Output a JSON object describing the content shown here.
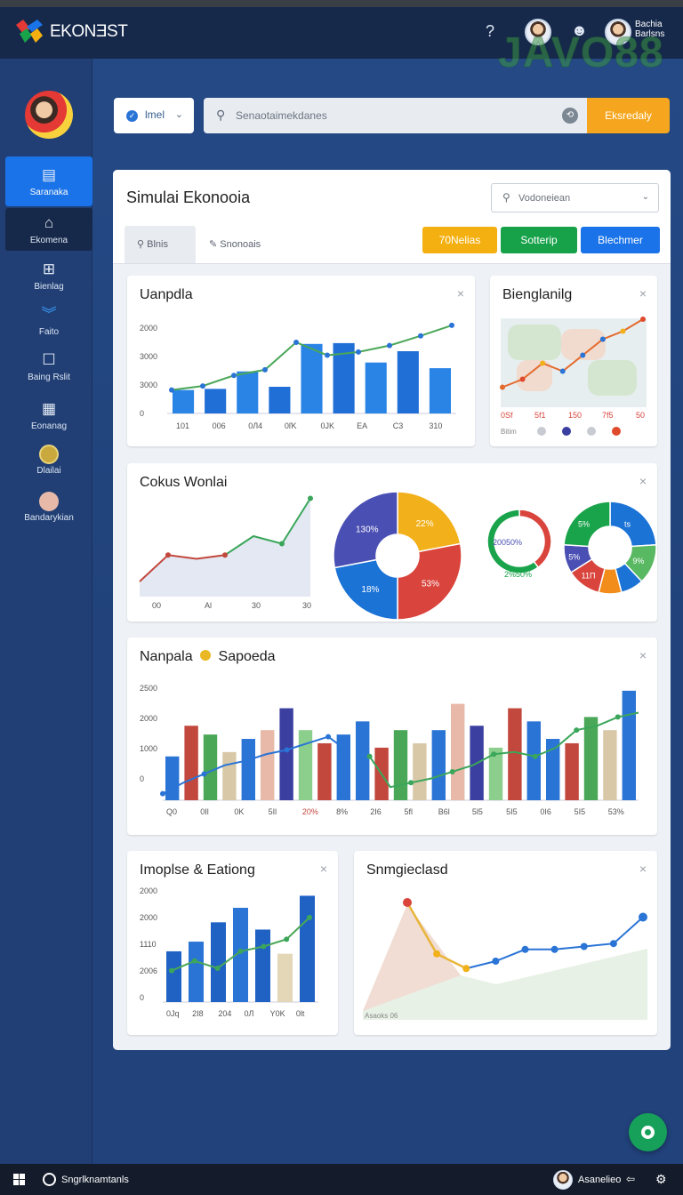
{
  "app": {
    "name": "EKONƎST",
    "watermark": "JAVO88"
  },
  "header": {
    "user_name_line1": "Bachia",
    "user_name_line2": "Barlsns"
  },
  "sidebar": {
    "items": [
      {
        "label": "Saranaka",
        "icon": "inbox-icon"
      },
      {
        "label": "Ekomena",
        "icon": "home-icon"
      },
      {
        "label": "Bienlag",
        "icon": "grid-icon"
      },
      {
        "label": "Faito",
        "icon": "chevrons-icon"
      },
      {
        "label": "Baing Rslit",
        "icon": "square-icon"
      },
      {
        "label": "Eonanag",
        "icon": "table-icon"
      },
      {
        "label": "Dlailai",
        "icon": "coin-icon"
      },
      {
        "label": "Bandarykian",
        "icon": "person-icon"
      }
    ]
  },
  "toolbar": {
    "filter_label": "lmel",
    "search_placeholder": "Senaotaimekdanes",
    "search_button": "Eksredaly"
  },
  "panel": {
    "title": "Simulai Ekonooia",
    "dropdown": "Vodoneiean",
    "tabs": [
      "Blnis",
      "Snonoais"
    ],
    "buttons": [
      {
        "label": "70Nelias",
        "color": "#f4b010"
      },
      {
        "label": "Sotterip",
        "color": "#17a24a"
      },
      {
        "label": "Blechmer",
        "color": "#1a73e8"
      }
    ]
  },
  "cards": {
    "c1": {
      "title": "Uanpdla",
      "close": "×"
    },
    "c2": {
      "title": "Bienglanilg",
      "close": "×",
      "legend_label": "Bitim"
    },
    "c3": {
      "title": "Cokus Wonlai",
      "close": "×"
    },
    "c4": {
      "title": "Nanpala",
      "title2": "Sapoeda",
      "close": "×"
    },
    "c5": {
      "title": "Imoplse & Eationg",
      "close": "×"
    },
    "c6": {
      "title": "Snmgieclasd",
      "close": "×",
      "caption": "Asaoks 06"
    }
  },
  "chart_data": [
    {
      "type": "bar",
      "title": "Uanpdla",
      "y_ticks": [
        "2000",
        "3000",
        "3000",
        "0"
      ],
      "categories": [
        "101",
        "006",
        "0Л4",
        "0ľK",
        "0JK",
        "EA",
        "C3",
        "310"
      ],
      "series": [
        {
          "values": [
            1450,
            1520,
            2600,
            1650,
            4300,
            4350,
            3150,
            3850,
            2800
          ]
        },
        {
          "values": [
            1450,
            1700,
            2350,
            2700,
            4400,
            3600,
            3800,
            4200,
            4800,
            5450
          ]
        }
      ],
      "ylim": [
        0,
        5500
      ]
    },
    {
      "type": "line",
      "title": "Bienglanilg",
      "categories": [
        "0Sf",
        "5f1",
        "150",
        "7f5",
        "50"
      ],
      "values": [
        5,
        15,
        35,
        25,
        45,
        65,
        75,
        90
      ],
      "legend_colors": [
        "#c8ccd2",
        "#3b3fa0",
        "#c8ccd2",
        "#e04a2c"
      ]
    },
    {
      "type": "area",
      "title": "Cokus Wonlai",
      "categories": [
        "00",
        "Al",
        "30",
        "30"
      ],
      "values": [
        20,
        55,
        50,
        55,
        80,
        70,
        130
      ]
    },
    {
      "type": "pie",
      "slices": [
        {
          "label": "22%",
          "value": 22,
          "color": "#f2b01a"
        },
        {
          "label": "53%",
          "value": 28,
          "color": "#d9443c"
        },
        {
          "label": "18%",
          "value": 22,
          "color": "#1c73d6"
        },
        {
          "label": "130%",
          "value": 28,
          "color": "#4a4fb3"
        }
      ]
    },
    {
      "type": "pie",
      "center_label": "20050%",
      "bottom_label": "2%50%",
      "slices": [
        {
          "value": 40,
          "color": "#d9443c"
        },
        {
          "value": 60,
          "color": "#19a34a"
        }
      ]
    },
    {
      "type": "pie",
      "slices": [
        {
          "label": "ts",
          "value": 24,
          "color": "#1c73d6"
        },
        {
          "label": "9%",
          "value": 14,
          "color": "#59b862"
        },
        {
          "label": "",
          "value": 8,
          "color": "#1c73d6"
        },
        {
          "label": "",
          "value": 8,
          "color": "#f28c1a"
        },
        {
          "label": "11П",
          "value": 12,
          "color": "#d9443c"
        },
        {
          "label": "5%",
          "value": 10,
          "color": "#4a4fb3"
        },
        {
          "label": "5%",
          "value": 24,
          "color": "#19a34a"
        }
      ]
    },
    {
      "type": "bar",
      "title": "Nanpala Sapoeda",
      "y_ticks": [
        "2500",
        "2000",
        "1000",
        "0"
      ],
      "categories": [
        "Q0",
        "0Il",
        "0K",
        "5Il",
        "20%",
        "8%",
        "2I6",
        "5fl",
        "B6l",
        "5l5",
        "5I5",
        "0I6",
        "5I5",
        "53%"
      ],
      "series": [
        {
          "values": [
            1000,
            1700,
            1500,
            1100,
            1400,
            1600,
            2100,
            1600,
            1300,
            1500,
            1800,
            1200,
            1600,
            1300,
            1600,
            2200,
            1700,
            1200,
            2100,
            1800,
            1400,
            1300,
            1900,
            1600,
            2500
          ]
        },
        {
          "values": [
            150,
            400,
            600,
            800,
            900,
            1050,
            1150,
            1300,
            1450,
            1100,
            1000,
            300,
            400,
            500,
            650,
            800,
            1050,
            1100,
            1000,
            1200,
            1600,
            1700,
            1900,
            2000
          ]
        }
      ],
      "ylim": [
        0,
        2700
      ]
    },
    {
      "type": "bar",
      "title": "Imoplse & Eationg",
      "y_ticks": [
        "2000",
        "2000",
        "1110",
        "2006",
        "0"
      ],
      "categories": [
        "0Jq",
        "2I8",
        "204",
        "0Л",
        "Y0K",
        "0lt"
      ],
      "series": [
        {
          "values": [
            2100,
            2500,
            3300,
            3900,
            3000,
            2000,
            4400
          ]
        },
        {
          "values": [
            1300,
            1700,
            1400,
            2100,
            2300,
            2600,
            3500
          ]
        }
      ],
      "ylim": [
        0,
        4600
      ]
    },
    {
      "type": "line",
      "title": "Snmgieclasd",
      "values": [
        80,
        45,
        35,
        40,
        48,
        48,
        50,
        52,
        70
      ],
      "caption": "Asaoks 06"
    }
  ],
  "taskbar": {
    "app_label": "Sngrlknamtanls",
    "user": "Asanelieo"
  }
}
